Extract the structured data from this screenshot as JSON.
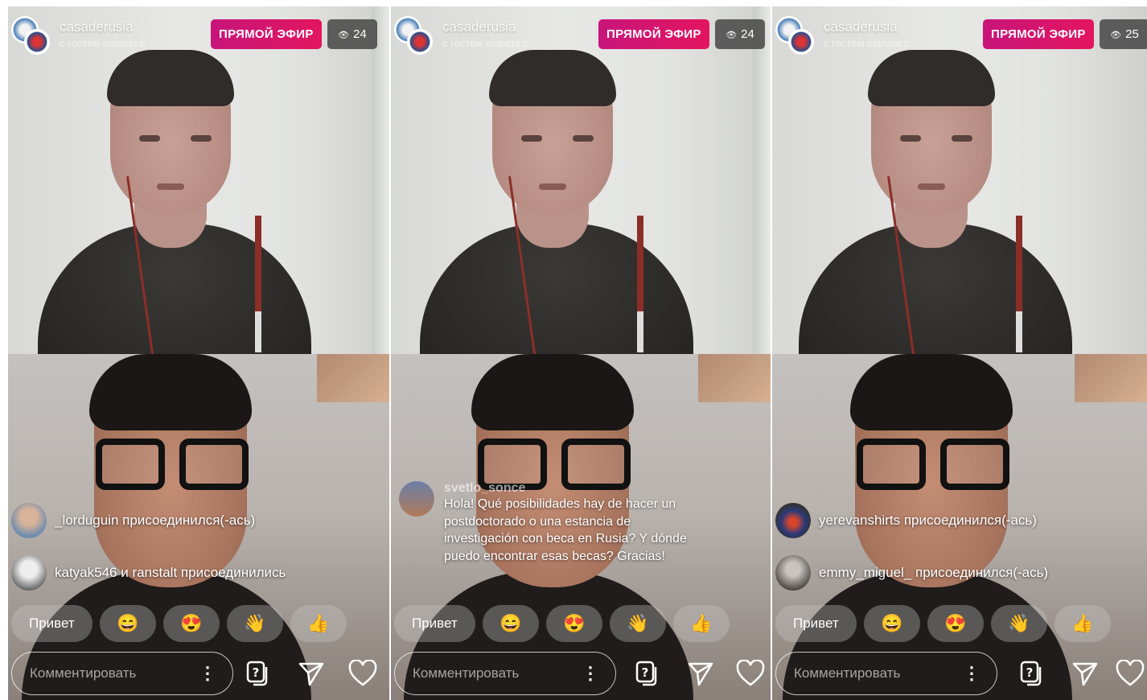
{
  "colors": {
    "live_badge": "#d4156d",
    "viewer_badge": "#3c3c3c"
  },
  "panels": [
    {
      "username": "casaderusia",
      "subtitle": "с гостем olaneta.c",
      "live_label": "ПРЯМОЙ ЭФИР",
      "viewers": "24",
      "joins": [
        {
          "text": "_lorduguin присоединился(-ась)"
        },
        {
          "text": "katyak546 и ranstalt присоединились"
        }
      ],
      "reactions": [
        {
          "label": "Привет",
          "kind": "text"
        },
        {
          "label": "😄",
          "kind": "emoji"
        },
        {
          "label": "😍",
          "kind": "emoji"
        },
        {
          "label": "👋",
          "kind": "emoji"
        },
        {
          "label": "👍",
          "kind": "emoji"
        }
      ],
      "comment_placeholder": "Комментировать"
    },
    {
      "username": "casaderusia",
      "subtitle": "с гостем olaneta.c",
      "live_label": "ПРЯМОЙ ЭФИР",
      "viewers": "24",
      "comment": {
        "user": "svetlo_sonce",
        "text": "Hola! Qué posibilidades hay de hacer un postdoctorado o una estancia de investigación con beca en Rusia? Y dónde puedo encontrar esas becas? Gracias!"
      },
      "reactions": [
        {
          "label": "Привет",
          "kind": "text"
        },
        {
          "label": "😄",
          "kind": "emoji"
        },
        {
          "label": "😍",
          "kind": "emoji"
        },
        {
          "label": "👋",
          "kind": "emoji"
        },
        {
          "label": "👍",
          "kind": "emoji"
        }
      ],
      "comment_placeholder": "Комментировать"
    },
    {
      "username": "casaderusia",
      "subtitle": "с гостем olaneta.c",
      "live_label": "ПРЯМОЙ ЭФИР",
      "viewers": "25",
      "joins": [
        {
          "text": "yerevanshirts присоединился(-ась)"
        },
        {
          "text": "emmy_miguel_ присоединился(-ась)"
        }
      ],
      "reactions": [
        {
          "label": "Привет",
          "kind": "text"
        },
        {
          "label": "😄",
          "kind": "emoji"
        },
        {
          "label": "😍",
          "kind": "emoji"
        },
        {
          "label": "👋",
          "kind": "emoji"
        },
        {
          "label": "👍",
          "kind": "emoji"
        }
      ],
      "comment_placeholder": "Комментировать"
    }
  ]
}
